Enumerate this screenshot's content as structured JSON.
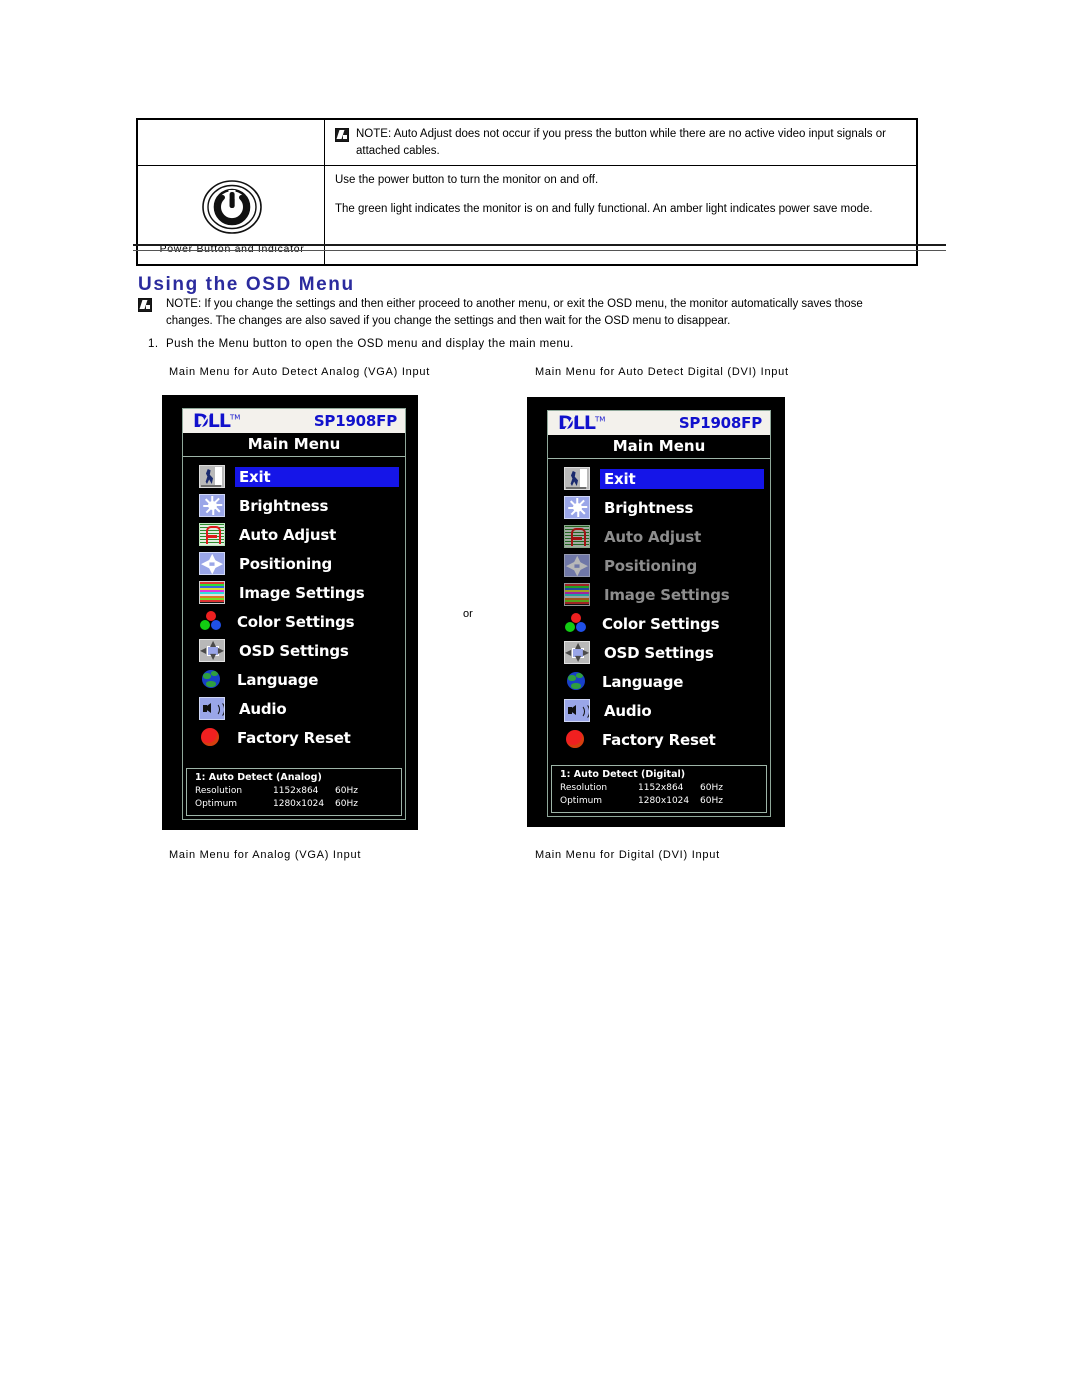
{
  "feature_table": {
    "rows": [
      {
        "icon": "",
        "caption": "",
        "paragraphs": [],
        "note": "NOTE: Auto Adjust does not occur if you press the button while there are no active video input signals or attached cables."
      },
      {
        "icon": "power-button-icon",
        "caption": "Power Button and Indicator",
        "paragraphs": [
          "Use the power button to turn the monitor on and off.",
          "The green light indicates the monitor is on and fully functional. An amber light indicates power save mode."
        ],
        "note": ""
      }
    ]
  },
  "section": {
    "title": "Using the OSD Menu",
    "title_color": "#2b2b9e",
    "note": "NOTE: If you change the settings and then either proceed to another menu, or exit the OSD menu, the monitor automatically saves those changes. The changes are also saved if you change the settings and then wait for the OSD menu to disappear.",
    "step_number": "1.",
    "step_text": "Push the Menu button to open the OSD menu and display the main menu."
  },
  "captions": {
    "top_left": "Main Menu for Auto Detect Analog (VGA) Input",
    "top_right": "Main Menu for Auto Detect Digital (DVI) Input",
    "bottom_left": "Main Menu for Analog (VGA) Input",
    "bottom_right": "Main Menu for Digital (DVI) Input",
    "separator": "or"
  },
  "osd_vga": {
    "brand": "D∕LL",
    "brand_tm": "TM",
    "model": "SP1908FP",
    "title": "Main Menu",
    "items": [
      {
        "label": "Exit",
        "icon": "exit-icon",
        "state": "selected"
      },
      {
        "label": "Brightness",
        "icon": "brightness-icon",
        "state": "normal"
      },
      {
        "label": "Auto Adjust",
        "icon": "auto-adjust-icon",
        "state": "normal"
      },
      {
        "label": "Positioning",
        "icon": "positioning-icon",
        "state": "normal"
      },
      {
        "label": "Image Settings",
        "icon": "image-settings-icon",
        "state": "normal"
      },
      {
        "label": "Color Settings",
        "icon": "color-settings-icon",
        "state": "normal"
      },
      {
        "label": "OSD Settings",
        "icon": "osd-settings-icon",
        "state": "normal"
      },
      {
        "label": "Language",
        "icon": "language-icon",
        "state": "normal"
      },
      {
        "label": "Audio",
        "icon": "audio-icon",
        "state": "normal"
      },
      {
        "label": "Factory Reset",
        "icon": "factory-reset-icon",
        "state": "normal"
      }
    ],
    "info": {
      "mode": "1: Auto Detect (Analog)",
      "rows": [
        {
          "key": "Resolution",
          "value": "1152x864",
          "rate": "60Hz"
        },
        {
          "key": "Optimum",
          "value": "1280x1024",
          "rate": "60Hz"
        }
      ]
    }
  },
  "osd_dvi": {
    "brand": "D∕LL",
    "brand_tm": "TM",
    "model": "SP1908FP",
    "title": "Main Menu",
    "items": [
      {
        "label": "Exit",
        "icon": "exit-icon",
        "state": "selected"
      },
      {
        "label": "Brightness",
        "icon": "brightness-icon",
        "state": "normal"
      },
      {
        "label": "Auto Adjust",
        "icon": "auto-adjust-icon",
        "state": "disabled"
      },
      {
        "label": "Positioning",
        "icon": "positioning-icon",
        "state": "disabled"
      },
      {
        "label": "Image Settings",
        "icon": "image-settings-icon",
        "state": "disabled"
      },
      {
        "label": "Color Settings",
        "icon": "color-settings-icon",
        "state": "normal"
      },
      {
        "label": "OSD Settings",
        "icon": "osd-settings-icon",
        "state": "normal"
      },
      {
        "label": "Language",
        "icon": "language-icon",
        "state": "normal"
      },
      {
        "label": "Audio",
        "icon": "audio-icon",
        "state": "normal"
      },
      {
        "label": "Factory Reset",
        "icon": "factory-reset-icon",
        "state": "normal"
      }
    ],
    "info": {
      "mode": "1: Auto Detect (Digital)",
      "rows": [
        {
          "key": "Resolution",
          "value": "1152x864",
          "rate": "60Hz"
        },
        {
          "key": "Optimum",
          "value": "1280x1024",
          "rate": "60Hz"
        }
      ]
    }
  }
}
